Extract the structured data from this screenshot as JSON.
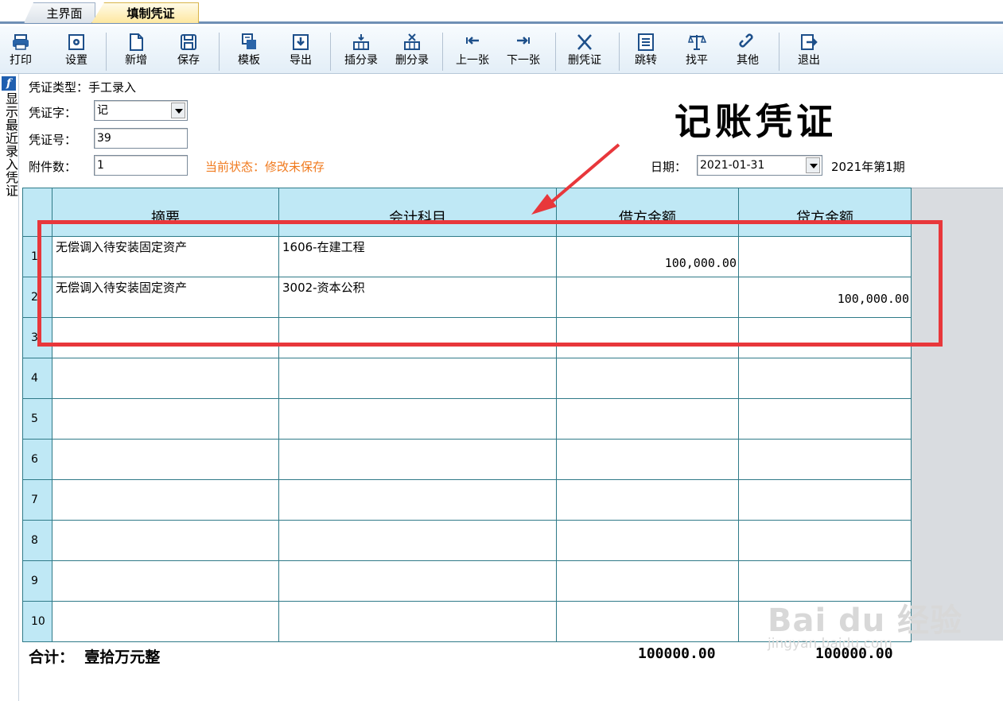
{
  "tabs": [
    {
      "label": "主界面"
    },
    {
      "label": "填制凭证",
      "active": true
    }
  ],
  "toolbar": {
    "print": "打印",
    "settings": "设置",
    "new": "新增",
    "save": "保存",
    "template": "模板",
    "export": "导出",
    "insert_entry": "插分录",
    "delete_entry": "删分录",
    "prev": "上一张",
    "next": "下一张",
    "delete_voucher": "删凭证",
    "jump": "跳转",
    "balance": "找平",
    "other": "其他",
    "exit": "退出"
  },
  "sidebar": {
    "badge": "f",
    "text": "显示最近录入凭证"
  },
  "voucher": {
    "type_label": "凭证类型：",
    "type_value": "手工录入",
    "word_label": "凭证字：",
    "word_value": "记",
    "number_label": "凭证号：",
    "number_value": "39",
    "attachments_label": "附件数：",
    "attachments_value": "1",
    "status": "当前状态：修改未保存",
    "title": "记账凭证",
    "date_label": "日期：",
    "date_value": "2021-01-31",
    "period": "2021年第1期"
  },
  "table": {
    "headers": [
      "摘要",
      "会计科目",
      "借方金额",
      "贷方金额"
    ],
    "rows": [
      {
        "n": "1",
        "summary": "无偿调入待安装固定资产",
        "account": "1606-在建工程",
        "debit": "100,000.00",
        "credit": ""
      },
      {
        "n": "2",
        "summary": "无偿调入待安装固定资产",
        "account": "3002-资本公积",
        "debit": "",
        "credit": "100,000.00"
      },
      {
        "n": "3",
        "summary": "",
        "account": "",
        "debit": "",
        "credit": ""
      },
      {
        "n": "4",
        "summary": "",
        "account": "",
        "debit": "",
        "credit": ""
      },
      {
        "n": "5",
        "summary": "",
        "account": "",
        "debit": "",
        "credit": ""
      },
      {
        "n": "6",
        "summary": "",
        "account": "",
        "debit": "",
        "credit": ""
      },
      {
        "n": "7",
        "summary": "",
        "account": "",
        "debit": "",
        "credit": ""
      },
      {
        "n": "8",
        "summary": "",
        "account": "",
        "debit": "",
        "credit": ""
      },
      {
        "n": "9",
        "summary": "",
        "account": "",
        "debit": "",
        "credit": ""
      },
      {
        "n": "10",
        "summary": "",
        "account": "",
        "debit": "",
        "credit": ""
      }
    ]
  },
  "totals": {
    "label": "合计：",
    "words": "壹拾万元整",
    "debit": "100000.00",
    "credit": "100000.00"
  },
  "watermark": {
    "brand": "Bai du 经验",
    "url": "jingyan.baidu.com"
  },
  "colors": {
    "annotation": "#e8373b",
    "status": "#f07a1e",
    "header_fill": "#bfe8f5"
  }
}
